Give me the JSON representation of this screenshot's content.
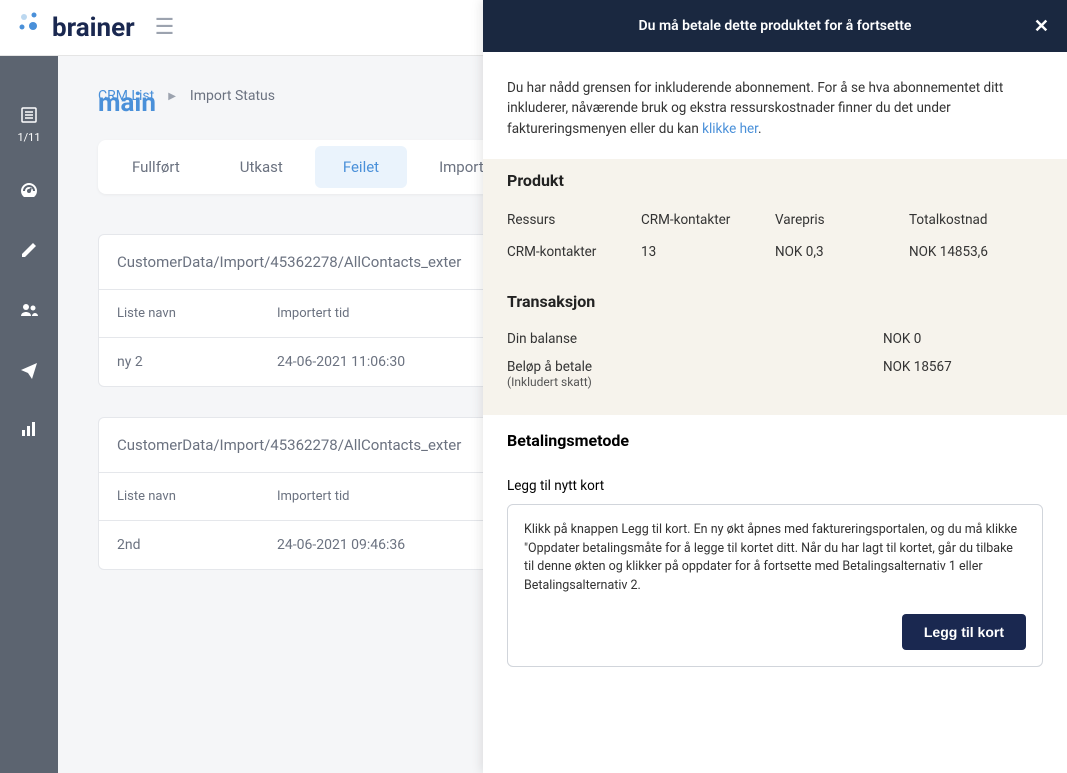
{
  "header": {
    "logo_main": "main",
    "logo_brainer": "brainer"
  },
  "sidebar": {
    "count": "1/11"
  },
  "breadcrumb": {
    "link": "CRM List",
    "current": "Import Status"
  },
  "tabs": {
    "completed": "Fullført",
    "draft": "Utkast",
    "failed": "Feilet",
    "import": "Import"
  },
  "cards": [
    {
      "title": "CustomerData/Import/45362278/AllContacts_exter",
      "headers": {
        "listname": "Liste navn",
        "imported": "Importert tid"
      },
      "row": {
        "listname": "ny 2",
        "imported": "24-06-2021 11:06:30"
      }
    },
    {
      "title": "CustomerData/Import/45362278/AllContacts_exter",
      "headers": {
        "listname": "Liste navn",
        "imported": "Importert tid"
      },
      "row": {
        "listname": "2nd",
        "imported": "24-06-2021 09:46:36"
      }
    }
  ],
  "panel": {
    "title": "Du må betale dette produktet for å fortsette",
    "intro_part1": "Du har nådd grensen for inkluderende abonnement. For å se hva abonnementet ditt inkluderer, nåværende bruk og ekstra ressurskostnader finner du det under faktureringsmenyen eller du kan ",
    "intro_link": "klikke her",
    "intro_part2": ".",
    "product": {
      "title": "Produkt",
      "header": {
        "resource": "Ressurs",
        "crm": "CRM-kontakter",
        "unitprice": "Varepris",
        "totalcost": "Totalkostnad"
      },
      "row": {
        "resource": "CRM-kontakter",
        "crm": "13",
        "unitprice": "NOK 0,3",
        "totalcost": "NOK 14853,6"
      }
    },
    "transaction": {
      "title": "Transaksjon",
      "balance_label": "Din balanse",
      "balance_value": "NOK 0",
      "topay_label": "Beløp å betale",
      "topay_sub": "(Inkludert skatt)",
      "topay_value": "NOK 18567"
    },
    "payment": {
      "title": "Betalingsmetode",
      "addcard_label": "Legg til nytt kort",
      "addcard_text": "Klikk på knappen Legg til kort. En ny økt åpnes med faktureringsportalen, og du må klikke \"Oppdater betalingsmåte for å legge til kortet ditt. Når du har lagt til kortet, går du tilbake til denne økten og klikker på oppdater for å fortsette med Betalingsalternativ 1 eller Betalingsalternativ 2.",
      "addcard_btn": "Legg til kort"
    }
  }
}
